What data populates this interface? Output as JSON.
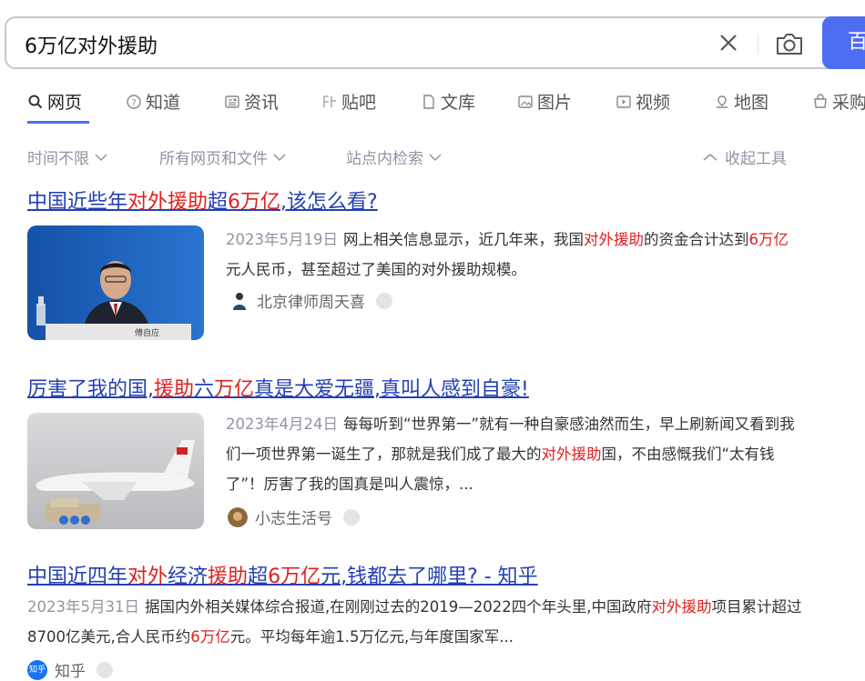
{
  "search": {
    "query": "6万亿对外援助",
    "button_label": "百度一下"
  },
  "tabs": [
    {
      "label": "网页",
      "icon": "search-icon"
    },
    {
      "label": "知道",
      "icon": "question-icon"
    },
    {
      "label": "资讯",
      "icon": "news-icon"
    },
    {
      "label": "贴吧",
      "icon": "tieba-icon"
    },
    {
      "label": "文库",
      "icon": "document-icon"
    },
    {
      "label": "图片",
      "icon": "image-icon"
    },
    {
      "label": "视频",
      "icon": "video-icon"
    },
    {
      "label": "地图",
      "icon": "map-icon"
    },
    {
      "label": "采购",
      "icon": "shopping-icon"
    }
  ],
  "filters": {
    "time": "时间不限",
    "type": "所有网页和文件",
    "site": "站点内检索",
    "collapse": "收起工具"
  },
  "results": [
    {
      "title": {
        "p1": "中国近些年",
        "h1": "对外援助",
        "p2": "超",
        "h2": "6万亿",
        "p3": ",该怎么看?"
      },
      "date": "2023年5月19日",
      "abstract": {
        "a1": "网上相关信息显示，近几年来，我国",
        "h1": "对外援助",
        "a2": "的资金合计达到",
        "h2": "6万亿",
        "a3": "元人民币，甚至超过了美国的对外援助规模。"
      },
      "source": "北京律师周天喜"
    },
    {
      "title": {
        "p1": "厉害了我的国,",
        "h1": "援助",
        "p2": "六",
        "h2": "万亿",
        "p3": "真是大爱无疆,真叫人感到自豪!"
      },
      "date": "2023年4月24日",
      "abstract": {
        "a1": "每每听到“世界第一”就有一种自豪感油然而生，早上刷新闻又看到我们一项世界第一诞生了，那就是我们成了最大的",
        "h1": "对外援助",
        "a2": "国，不由感慨我们“太有钱了”！厉害了我的国真是叫人震惊，..."
      },
      "source": "小志生活号"
    },
    {
      "title": {
        "p1": "中国近四年",
        "h1": "对外",
        "p2": "经济",
        "h2": "援助",
        "p3": "超",
        "h3": "6万亿",
        "p4": "元,钱都去了哪里? - 知乎"
      },
      "date": "2023年5月31日",
      "abstract": {
        "a1": "据国内外相关媒体综合报道,在刚刚过去的2019—2022四个年头里,中国政府",
        "h1": "对外援助",
        "a2": "项目累计超过8700亿美元,合人民币约",
        "h2": "6万亿",
        "a3": "元。平均每年逾1.5万亿元,与年度国家军..."
      },
      "source": "知乎",
      "source_badge": "知乎"
    }
  ],
  "colors": {
    "accent": "#4e6ef2",
    "title_link": "#2440b3",
    "highlight": "#e02020",
    "muted": "#9195a3"
  }
}
